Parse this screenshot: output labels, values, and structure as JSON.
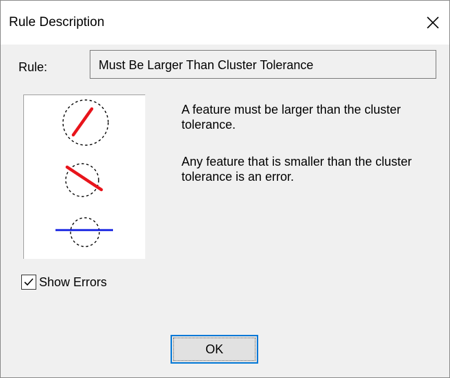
{
  "window": {
    "title": "Rule Description",
    "close_icon": "close-icon"
  },
  "rule": {
    "label": "Rule:",
    "value": "Must Be Larger Than Cluster Tolerance"
  },
  "description": {
    "line1": "A feature must be larger than the cluster tolerance.",
    "line2": "Any feature that is smaller than the cluster tolerance is an error."
  },
  "diagram": {
    "valid_color": "#e8141b",
    "invalid_color": "#0a18e0",
    "circle_color": "#000000"
  },
  "show_errors": {
    "label": "Show Errors",
    "checked": true
  },
  "buttons": {
    "ok": "OK"
  }
}
